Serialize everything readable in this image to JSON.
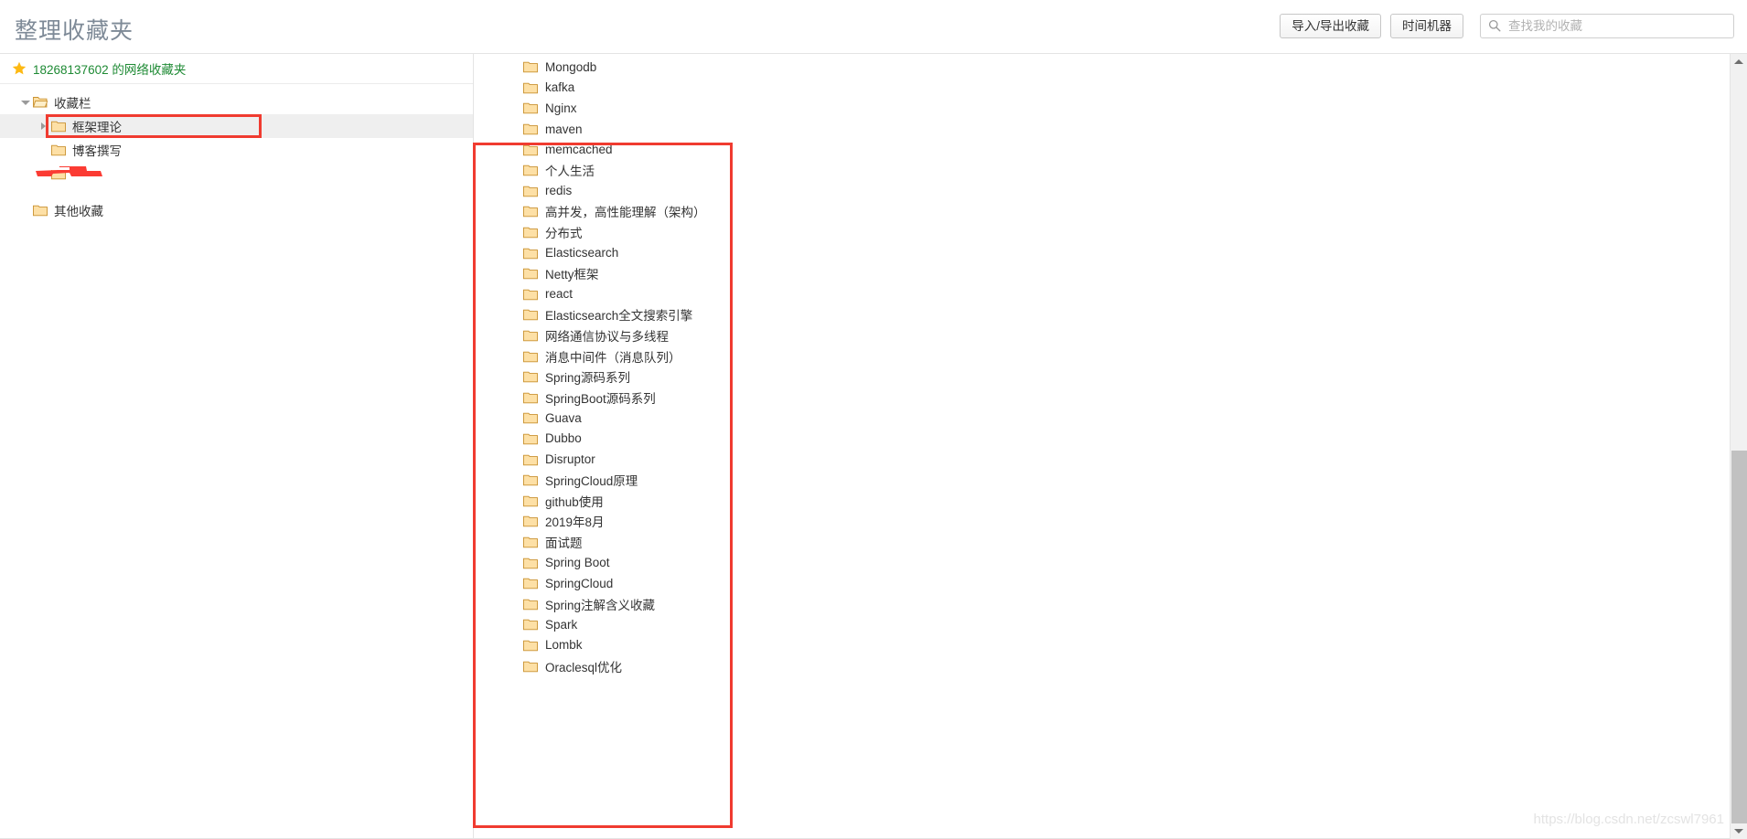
{
  "header": {
    "title": "整理收藏夹",
    "buttons": [
      {
        "label": "导入/导出收藏",
        "name": "import-export-button"
      },
      {
        "label": "时间机器",
        "name": "time-machine-button"
      }
    ],
    "search": {
      "placeholder": "查找我的收藏",
      "value": "",
      "icon": "search-icon"
    }
  },
  "sidebar": {
    "root": {
      "label": "18268137602 的网络收藏夹",
      "icon": "star-icon",
      "color": "#1e8a34"
    },
    "tree": [
      {
        "label": "收藏栏",
        "level": 0,
        "caret": "down",
        "selected": false,
        "redacted": false
      },
      {
        "label": "框架理论",
        "level": 1,
        "caret": "right",
        "selected": true,
        "redacted": false
      },
      {
        "label": "博客撰写",
        "level": 1,
        "caret": "blank",
        "selected": false,
        "redacted": false
      },
      {
        "label": "",
        "level": 1,
        "caret": "blank",
        "selected": false,
        "redacted": true
      },
      {
        "label": "其他收藏",
        "level": 0,
        "caret": "blank",
        "selected": false,
        "redacted": false
      }
    ]
  },
  "main": {
    "items": [
      "Mongodb",
      "kafka",
      "Nginx",
      "maven",
      "memcached",
      "个人生活",
      "redis",
      "高并发，高性能理解（架构）",
      "分布式",
      "Elasticsearch",
      "Netty框架",
      "react",
      "Elasticsearch全文搜索引擎",
      "网络通信协议与多线程",
      "消息中间件（消息队列）",
      "Spring源码系列",
      "SpringBoot源码系列",
      "Guava",
      "Dubbo",
      "Disruptor",
      "SpringCloud原理",
      "github使用",
      "2019年8月",
      "面试题",
      "Spring Boot",
      "SpringCloud",
      "Spring注解含义收藏",
      "Spark",
      "Lombk",
      "Oraclesql优化"
    ]
  },
  "annotations": {
    "color": "#f03b30",
    "tree_highlight_target": "框架理论",
    "list_highlight_start": "maven",
    "list_highlight_end": "Oraclesql优化"
  },
  "scrollbar": {
    "up_arrow": "scroll-up-arrow",
    "down_arrow": "scroll-down-arrow"
  },
  "watermark": {
    "text": "https://blog.csdn.net/zcswl7961"
  }
}
